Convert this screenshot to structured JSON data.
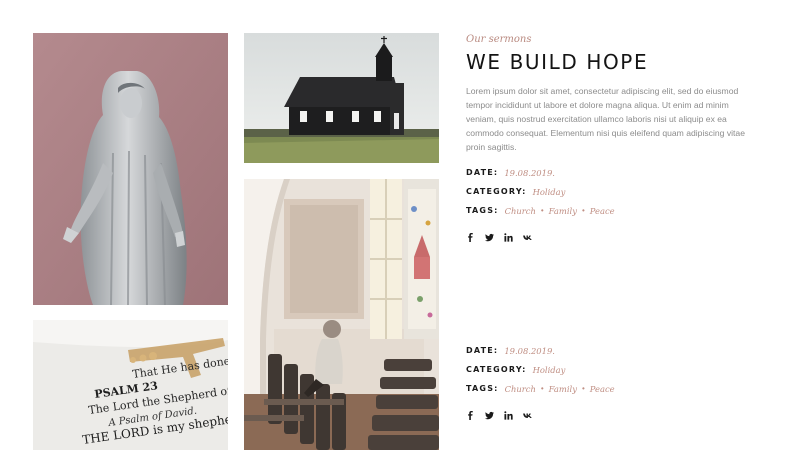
{
  "header": {
    "kicker": "Our sermons",
    "title": "WE BUILD HOPE",
    "description": "Lorem ipsum dolor sit amet, consectetur adipiscing elit, sed do eiusmod tempor incididunt ut labore et dolore magna aliqua. Ut enim ad minim veniam, quis nostrud exercitation ullamco laboris nisi ut aliquip ex ea commodo consequat. Elementum nisi quis eleifend quam adipiscing vitae proin sagittis."
  },
  "photos": {
    "bible_text": {
      "line1": "That He has done this.",
      "psalm": "PSALM 23",
      "line2": "The Lord the Shepherd of His",
      "line3": "A Psalm of David.",
      "line4": "THE LORD is my shepherd"
    }
  },
  "sermons": [
    {
      "date_label": "DATE:",
      "date": "19.08.2019.",
      "category_label": "CATEGORY:",
      "category": "Holiday",
      "tags_label": "TAGS:",
      "tags": [
        "Church",
        "Family",
        "Peace"
      ]
    },
    {
      "date_label": "DATE:",
      "date": "19.08.2019.",
      "category_label": "CATEGORY:",
      "category": "Holiday",
      "tags_label": "TAGS:",
      "tags": [
        "Church",
        "Family",
        "Peace"
      ]
    }
  ],
  "socials": [
    "facebook-icon",
    "twitter-icon",
    "linkedin-icon",
    "vk-icon"
  ],
  "colors": {
    "accent": "#c08f84",
    "heading": "#141414",
    "body_text": "#8c8c8c"
  }
}
